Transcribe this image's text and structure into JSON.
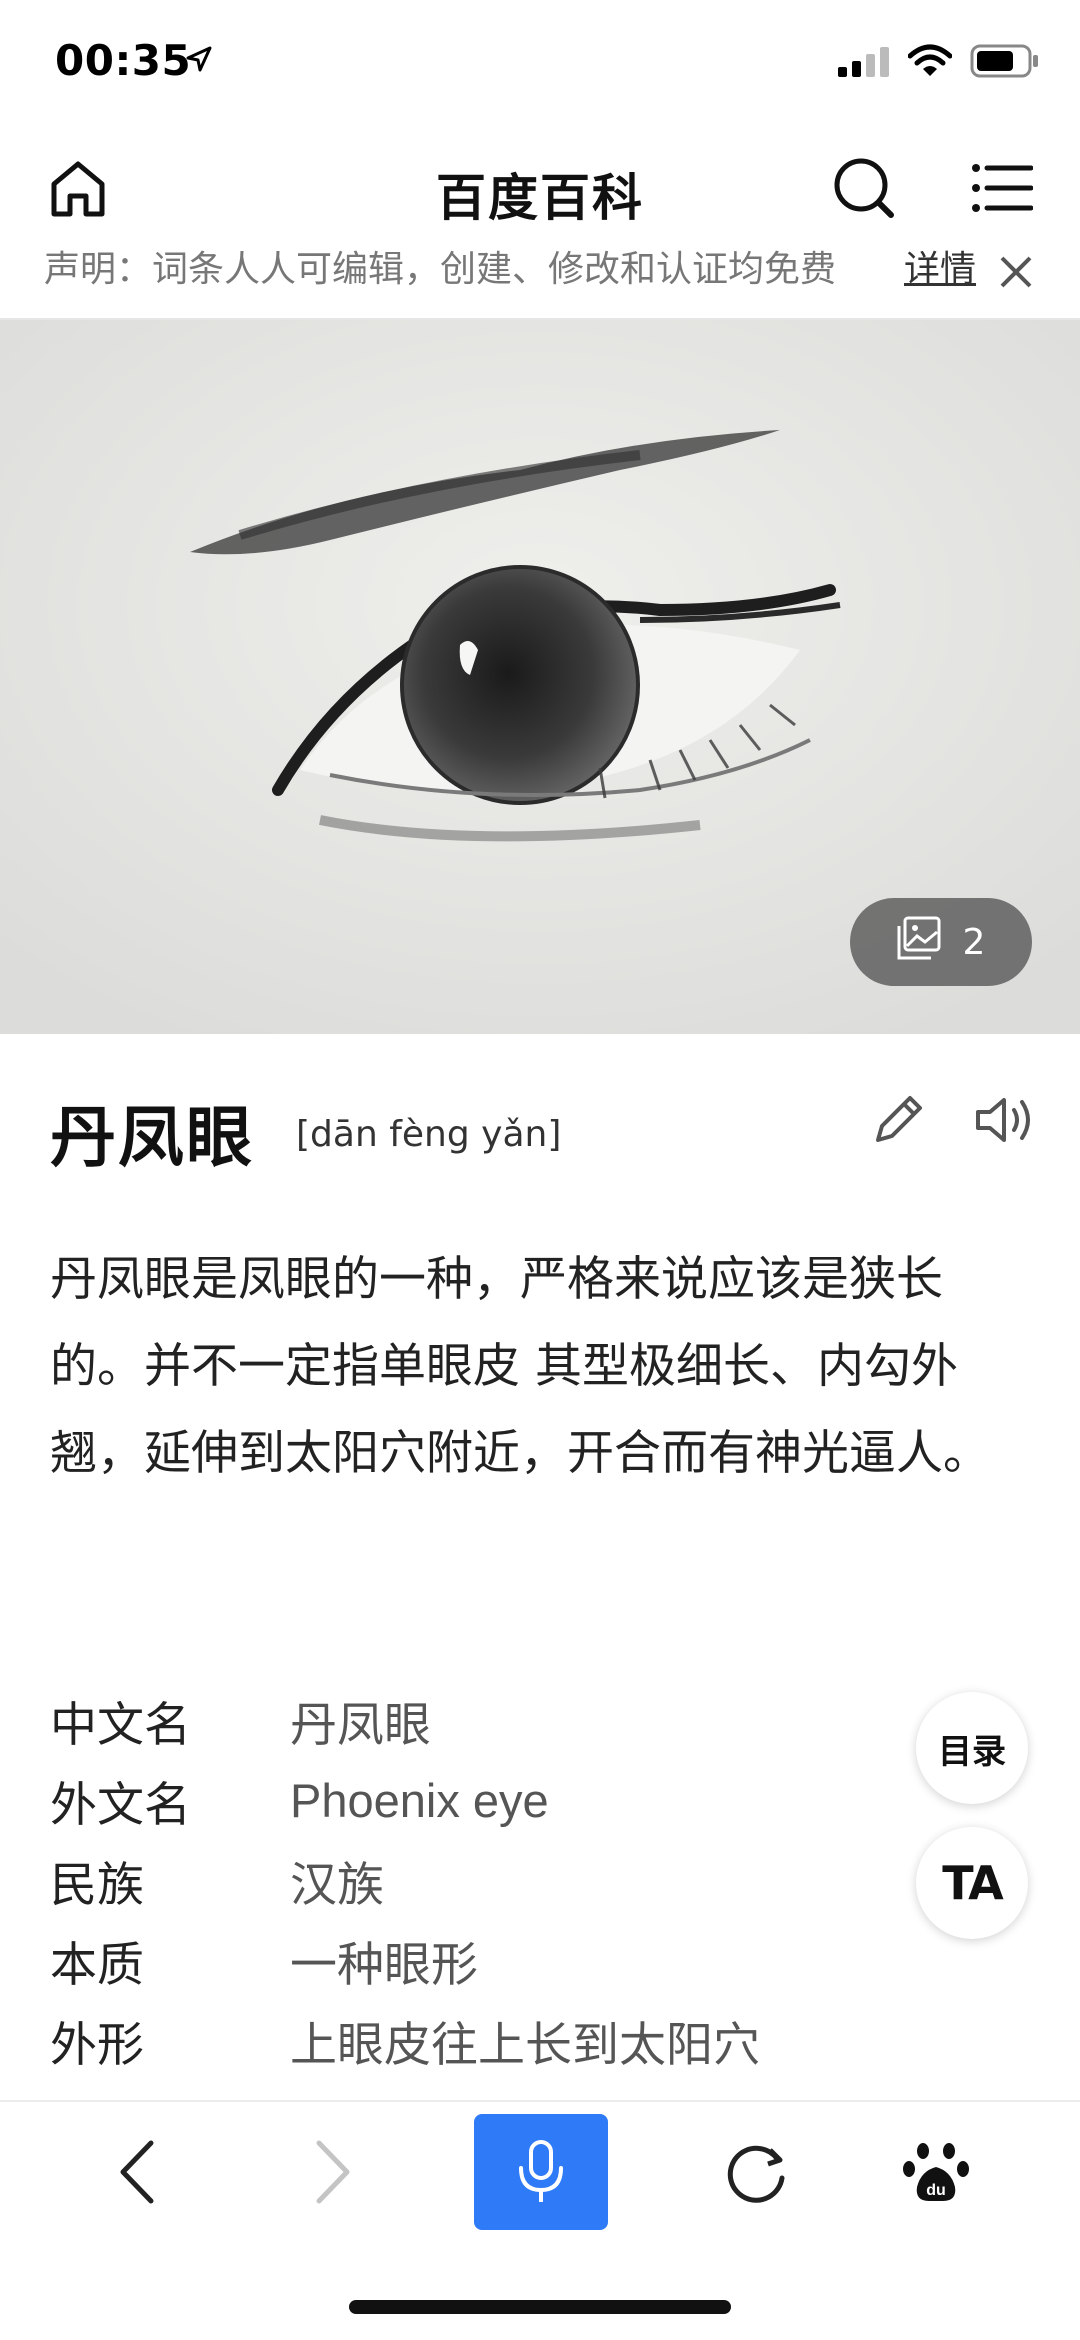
{
  "status_bar": {
    "time": "00:35",
    "icons": [
      "location-arrow-icon",
      "signal-icon",
      "wifi-icon",
      "battery-icon"
    ]
  },
  "header": {
    "title": "百度百科",
    "icons": [
      "home-icon",
      "search-icon",
      "menu-icon"
    ]
  },
  "notice": {
    "text": "声明：词条人人可编辑，创建、修改和认证均免费",
    "link_label": "详情",
    "close_icon": "close-icon"
  },
  "hero": {
    "gallery_count": "2",
    "gallery_icon": "gallery-icon"
  },
  "entry": {
    "title": "丹凤眼",
    "pinyin": "[dān fèng yǎn]",
    "edit_icon": "pencil-icon",
    "audio_icon": "speaker-icon",
    "summary": "丹凤眼是凤眼的一种，严格来说应该是狭长的。并不一定指单眼皮 其型极细长、内勾外翘，延伸到太阳穴附近，开合而有神光逼人。"
  },
  "info": [
    {
      "label": "中文名",
      "value": "丹凤眼"
    },
    {
      "label": "外文名",
      "value": "Phoenix eye"
    },
    {
      "label": "民族",
      "value": "汉族"
    },
    {
      "label": "本质",
      "value": "一种眼形"
    },
    {
      "label": "外形",
      "value": "上眼皮往上长到太阳穴"
    }
  ],
  "floating": {
    "toc_label": "目录",
    "ta_label": "TA"
  },
  "bottom_bar": {
    "icons": [
      "back-icon",
      "forward-icon",
      "microphone-icon",
      "refresh-icon",
      "baidu-paw-icon"
    ]
  },
  "colors": {
    "accent": "#2f7af7",
    "pill_bg": "#5a5a5a"
  }
}
